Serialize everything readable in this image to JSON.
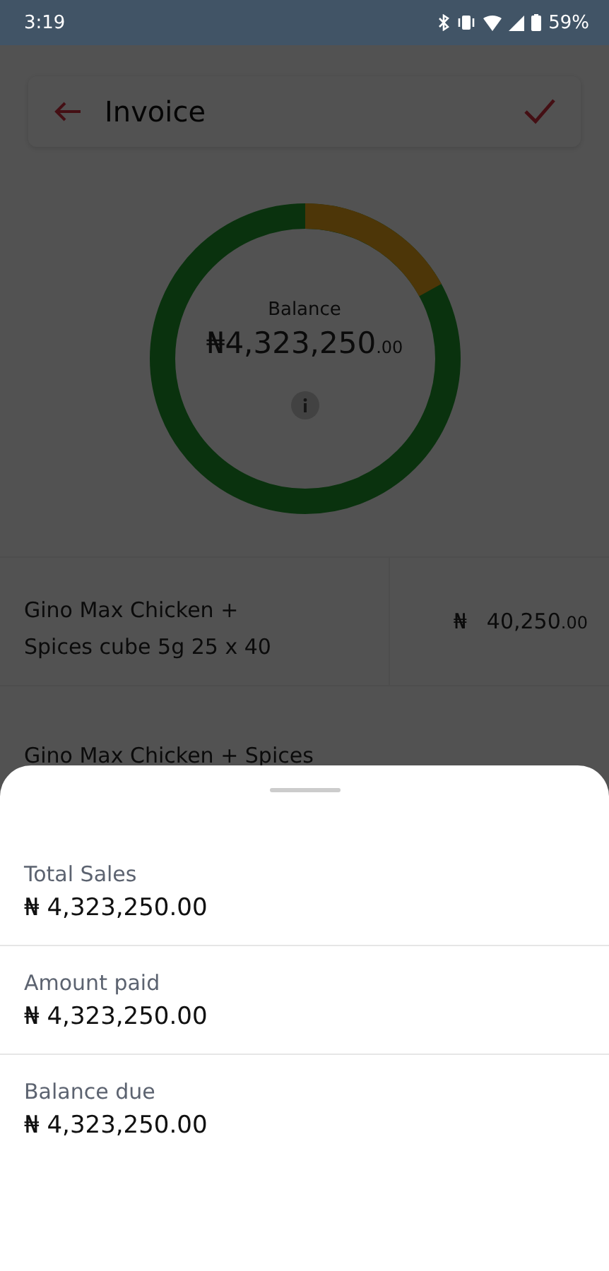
{
  "status_bar": {
    "time": "3:19",
    "battery": "59%"
  },
  "header": {
    "title": "Invoice"
  },
  "balance": {
    "label": "Balance",
    "amount": "₦4,323,250",
    "cents": ".00"
  },
  "items": [
    {
      "name": "Gino Max Chicken + Spices cube 5g 25 x 40",
      "currency": "₦",
      "amount": "40,250",
      "cents": ".00"
    },
    {
      "name": "Gino Max Chicken + Spices"
    }
  ],
  "sheet": {
    "rows": [
      {
        "label": "Total Sales",
        "value": "₦ 4,323,250.00"
      },
      {
        "label": "Amount paid",
        "value": "₦ 4,323,250.00"
      },
      {
        "label": "Balance due",
        "value": "₦ 4,323,250.00"
      }
    ]
  }
}
